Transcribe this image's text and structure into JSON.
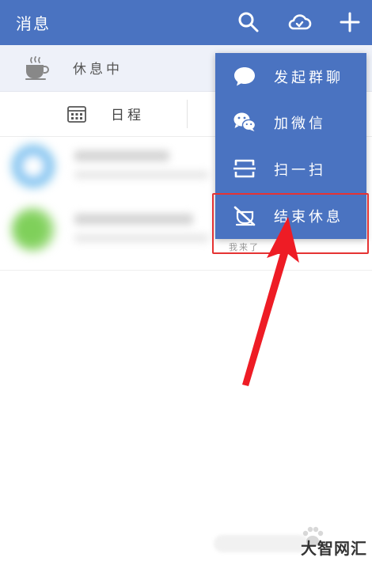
{
  "header": {
    "title": "消息",
    "icons": [
      "search-icon",
      "cloud-icon",
      "plus-icon"
    ],
    "color": "#4a73c1"
  },
  "status": {
    "label": "休息中",
    "icon": "coffee-cup-icon"
  },
  "tabs": {
    "schedule_label": "日程",
    "icon": "calendar-icon"
  },
  "menu": {
    "items": [
      {
        "label": "发起群聊",
        "icon": "chat-bubble-icon"
      },
      {
        "label": "加微信",
        "icon": "wechat-icon"
      },
      {
        "label": "扫一扫",
        "icon": "scan-icon"
      },
      {
        "label": "结束休息",
        "icon": "end-rest-icon"
      }
    ]
  },
  "list": {
    "preview_text": "我来了"
  },
  "annotation": {
    "highlight_color": "#e53333"
  },
  "watermark": {
    "text": "大智网汇"
  }
}
